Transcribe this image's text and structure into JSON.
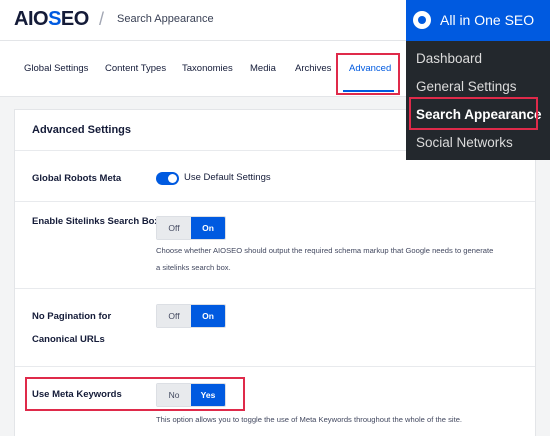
{
  "header": {
    "logo_text": "AIOSEO",
    "logo_pre": "AIO",
    "logo_gear": "S",
    "logo_post": "EO",
    "separator": "/",
    "breadcrumb": "Search Appearance"
  },
  "tabs": [
    {
      "label": "Global Settings"
    },
    {
      "label": "Content Types"
    },
    {
      "label": "Taxonomies"
    },
    {
      "label": "Media"
    },
    {
      "label": "Archives"
    },
    {
      "label": "Advanced",
      "active": true
    }
  ],
  "card": {
    "title": "Advanced Settings",
    "rows": {
      "robots": {
        "label": "Global Robots Meta",
        "toggle_label": "Use Default Settings",
        "toggle_on": true
      },
      "sitelinks": {
        "label": "Enable Sitelinks Search Box",
        "off": "Off",
        "on": "On",
        "selected": "On",
        "description_line1": "Choose whether AIOSEO should output the required schema markup that Google needs to generate",
        "description_line2": "a sitelinks search box."
      },
      "pagination": {
        "label_line1": "No Pagination for",
        "label_line2": "Canonical URLs",
        "off": "Off",
        "on": "On",
        "selected": "On"
      },
      "keywords": {
        "label": "Use Meta Keywords",
        "off": "No",
        "on": "Yes",
        "selected": "Yes",
        "description": "This option allows you to toggle the use of Meta Keywords throughout the whole of the site."
      }
    }
  },
  "admin_menu": {
    "title": "All in One SEO",
    "items": [
      {
        "label": "Dashboard"
      },
      {
        "label": "General Settings"
      },
      {
        "label": "Search Appearance",
        "current": true
      },
      {
        "label": "Social Networks"
      }
    ]
  },
  "colors": {
    "accent": "#005ae0",
    "highlight": "#df2a4a",
    "admin_bg": "#23282d"
  },
  "icons": {
    "logo_gear": "aioseo-gear-icon",
    "admin_logo": "aioseo-logo-icon"
  }
}
